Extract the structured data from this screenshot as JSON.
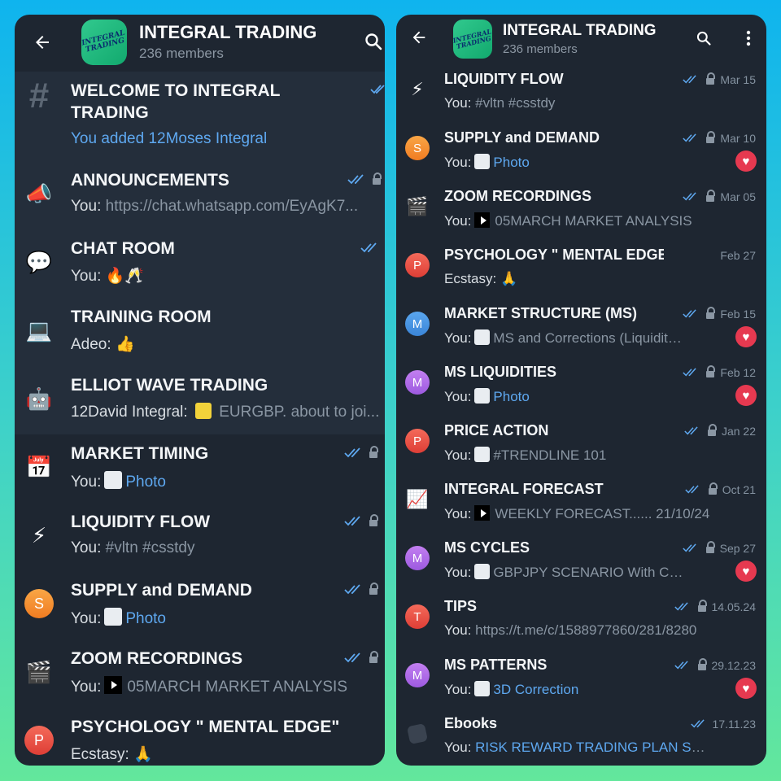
{
  "colors": {
    "panel_bg": "#1e2631",
    "accent_blue": "#5ea8f0",
    "heart_red": "#e63950",
    "muted": "#8a96a3"
  },
  "group": {
    "title": "INTEGRAL TRADING",
    "members": "236 members",
    "avatar_text": "INTEGRAL\nTRADING"
  },
  "left": {
    "chats": [
      {
        "icon": "hash-icon",
        "glyph": "#",
        "title_line1": "WELCOME TO INTEGRAL",
        "title_line2": "TRADING",
        "subtitle": "You added 12Moses Integral"
      },
      {
        "icon": "megaphone-icon",
        "glyph": "📣",
        "title": "ANNOUNCEMENTS",
        "sender": "You:",
        "message": "https://chat.whatsapp.com/EyAgK7..."
      },
      {
        "icon": "speech-bubble-icon",
        "glyph": "💬",
        "title": "CHAT ROOM",
        "sender": "You:",
        "message": "🔥🥂"
      },
      {
        "icon": "laptop-icon",
        "glyph": "💻",
        "title": "TRAINING ROOM",
        "sender": "Adeo:",
        "message": "👍"
      },
      {
        "icon": "robot-icon",
        "glyph": "🤖",
        "title": "ELLIOT WAVE TRADING",
        "sender": "12David Integral:",
        "message": "EURGBP. about to joi..."
      },
      {
        "icon": "calendar-icon",
        "glyph": "📅",
        "title": "MARKET TIMING",
        "sender": "You:",
        "message": "Photo"
      },
      {
        "icon": "lightning-icon",
        "glyph": "⚡",
        "title": "LIQUIDITY FLOW",
        "sender": "You:",
        "message": "#vltn #csstdy"
      },
      {
        "icon": "letter-s-avatar",
        "letter": "S",
        "title": "SUPPLY and DEMAND",
        "sender": "You:",
        "message": "Photo"
      },
      {
        "icon": "clapper-board-icon",
        "glyph": "🎬",
        "title": "ZOOM RECORDINGS",
        "sender": "You:",
        "message": "05MARCH MARKET ANALYSIS"
      },
      {
        "icon": "letter-p-avatar",
        "letter": "P",
        "title": "PSYCHOLOGY \" MENTAL EDGE\"",
        "sender": "Ecstasy:",
        "message": "🙏"
      }
    ]
  },
  "right": {
    "chats": [
      {
        "icon": "lightning-icon",
        "glyph": "⚡",
        "title": "LIQUIDITY FLOW",
        "date": "Mar 15",
        "sender": "You:",
        "message": "#vltn #csstdy"
      },
      {
        "icon": "letter-s-avatar",
        "letter": "S",
        "title": "SUPPLY and DEMAND",
        "date": "Mar 10",
        "sender": "You:",
        "message": "Photo"
      },
      {
        "icon": "clapper-board-icon",
        "glyph": "🎬",
        "title": "ZOOM RECORDINGS",
        "date": "Mar 05",
        "sender": "You:",
        "message": "05MARCH MARKET ANALYSIS"
      },
      {
        "icon": "letter-p-avatar",
        "letter": "P",
        "title": "PSYCHOLOGY \" MENTAL EDGE\"",
        "date": "Feb 27",
        "sender": "Ecstasy:",
        "message": "🙏"
      },
      {
        "icon": "letter-m-avatar",
        "letter": "M",
        "title": "MARKET STRUCTURE (MS)",
        "date": "Feb 15",
        "sender": "You:",
        "message": "MS and Corrections (Liquidity Buil..."
      },
      {
        "icon": "letter-m-avatar",
        "letter": "M",
        "title": "MS LIQUIDITIES",
        "date": "Feb 12",
        "sender": "You:",
        "message": "Photo"
      },
      {
        "icon": "letter-p-avatar",
        "letter": "P",
        "title": "PRICE ACTION",
        "date": "Jan 22",
        "sender": "You:",
        "message": "#TRENDLINE 101"
      },
      {
        "icon": "chart-increasing-icon",
        "glyph": "📈",
        "title": "INTEGRAL FORECAST",
        "date": "Oct 21",
        "sender": "You:",
        "message": "WEEKLY FORECAST...... 21/10/24"
      },
      {
        "icon": "letter-m-avatar",
        "letter": "M",
        "title": "MS CYCLES",
        "date": "Sep 27",
        "sender": "You:",
        "message": "GBPJPY SCENARIO  With Channel..."
      },
      {
        "icon": "letter-t-avatar",
        "letter": "T",
        "title": "TIPS",
        "date": "14.05.24",
        "sender": "You:",
        "message": "https://t.me/c/1588977860/281/8280"
      },
      {
        "icon": "letter-m-avatar",
        "letter": "M",
        "title": "MS PATTERNS",
        "date": "29.12.23",
        "sender": "You:",
        "message": "3D Correction"
      },
      {
        "icon": "book-icon",
        "glyph": "",
        "title": "Ebooks",
        "date": "17.11.23",
        "sender": "You:",
        "message": "RISK REWARD TRADING PLAN SAMPLE..."
      }
    ]
  }
}
